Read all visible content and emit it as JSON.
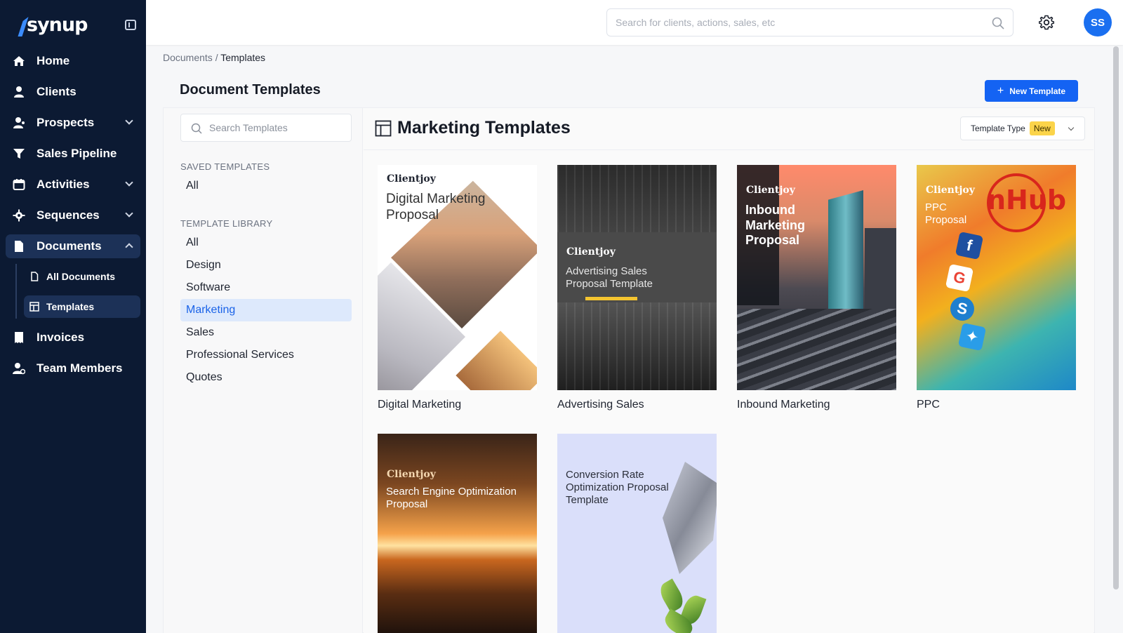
{
  "app": {
    "logo_text": "synup",
    "brand_color": "#1a6ff0",
    "sidebar_bg": "#0c1a33"
  },
  "sidebar": {
    "items": [
      {
        "label": "Home",
        "icon": "home-icon"
      },
      {
        "label": "Clients",
        "icon": "user-icon"
      },
      {
        "label": "Prospects",
        "icon": "prospect-icon"
      },
      {
        "label": "Sales Pipeline",
        "icon": "funnel-icon"
      },
      {
        "label": "Activities",
        "icon": "calendar-icon"
      },
      {
        "label": "Sequences",
        "icon": "gear-icon"
      },
      {
        "label": "Documents",
        "icon": "document-icon"
      },
      {
        "label": "Invoices",
        "icon": "invoice-icon"
      },
      {
        "label": "Team Members",
        "icon": "team-icon"
      }
    ],
    "documents_sub": [
      {
        "label": "All Documents",
        "icon": "file-icon"
      },
      {
        "label": "Templates",
        "icon": "template-icon"
      }
    ]
  },
  "topbar": {
    "search_placeholder": "Search for clients, actions, sales, etc",
    "avatar_initials": "SS"
  },
  "breadcrumb": {
    "parent": "Documents",
    "separator": " / ",
    "current": "Templates"
  },
  "page": {
    "title": "Document Templates",
    "new_button": "New Template"
  },
  "left_panel": {
    "search_placeholder": "Search Templates",
    "saved_label": "SAVED TEMPLATES",
    "saved_items": [
      "All"
    ],
    "library_label": "TEMPLATE LIBRARY",
    "library_items": [
      "All",
      "Design",
      "Software",
      "Marketing",
      "Sales",
      "Professional Services",
      "Quotes"
    ],
    "active_item": "Marketing"
  },
  "right_panel": {
    "title": "Marketing Templates",
    "filter_label": "Template Type",
    "filter_badge": "New"
  },
  "templates": [
    {
      "label": "Digital Marketing",
      "brand": "Clientjoy",
      "title": "Digital Marketing Proposal"
    },
    {
      "label": "Advertising Sales",
      "brand": "Clientjoy",
      "title": "Advertising Sales Proposal Template"
    },
    {
      "label": "Inbound Marketing",
      "brand": "Clientjoy",
      "title": "Inbound Marketing Proposal"
    },
    {
      "label": "PPC",
      "brand": "Clientjoy",
      "title": "PPC Proposal",
      "logo": "nHub"
    },
    {
      "label": "",
      "brand": "Clientjoy",
      "title": "Search Engine Optimization Proposal"
    },
    {
      "label": "",
      "brand": "",
      "title": "Conversion Rate Optimization Proposal Template"
    }
  ]
}
